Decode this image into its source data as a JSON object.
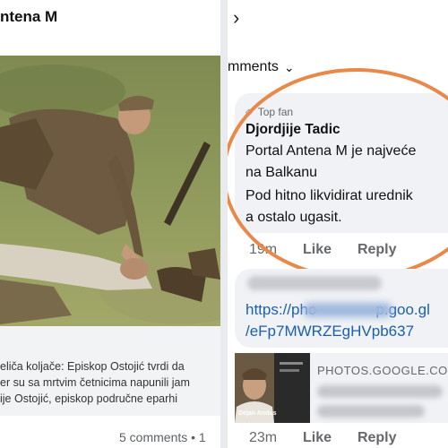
{
  "left": {
    "page_title": "ntena M",
    "caption_lines": [
      "eliča koljače: Episkop Ostojić tvrdi da",
      "er su sa mrtvim četnicima napunili jam",
      "ije Ostojić, episkop područne eparhi"
    ],
    "comments_count": "5 comments • 1"
  },
  "right": {
    "nav_chevron": "›",
    "comments_header": "mments",
    "comment": {
      "badge": "Top fan",
      "author": "Djordjije Tadic",
      "lines": [
        "Portal Antena M je najveće",
        "na Balkanu",
        "Pod hitno likvidirat urednik",
        "a ostalo ugasit."
      ],
      "time": "19m",
      "like": "Like",
      "reply": "Reply"
    },
    "comment2": {
      "link_line1": "https://pho",
      "link_line1_end": "p.goo.gl",
      "link_line2": "/eFp7MWRZEgHVpb637",
      "preview_domain": "PHOTOS.GOOGLE.COM",
      "thumb_caption": "Dejan Andus",
      "time": "23m",
      "like": "Like",
      "reply": "Reply"
    }
  },
  "colors": {
    "highlight_oval": "#e8894a",
    "link": "#1b5fb0"
  },
  "icons": {
    "nav": "chevron-right-icon",
    "sort": "chevron-down-icon",
    "badge": "diamond-icon"
  }
}
